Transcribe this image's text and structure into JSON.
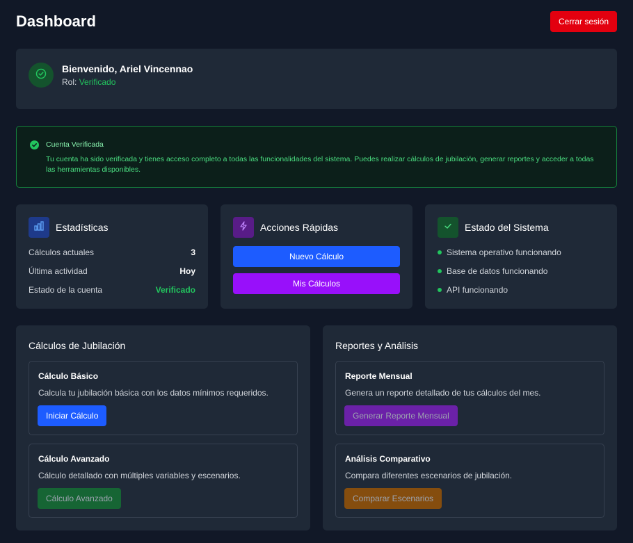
{
  "header": {
    "title": "Dashboard",
    "logout_label": "Cerrar sesión"
  },
  "welcome": {
    "greeting": "Bienvenido, Ariel Vincennao",
    "role_label": "Rol:",
    "role_value": "Verificado"
  },
  "alert": {
    "title": "Cuenta Verificada",
    "message": "Tu cuenta ha sido verificada y tienes acceso completo a todas las funcionalidades del sistema. Puedes realizar cálculos de jubilación, generar reportes y acceder a todas las herramientas disponibles."
  },
  "stats": {
    "title": "Estadísticas",
    "rows": [
      {
        "label": "Cálculos actuales",
        "value": "3"
      },
      {
        "label": "Última actividad",
        "value": "Hoy"
      },
      {
        "label": "Estado de la cuenta",
        "value": "Verificado"
      }
    ]
  },
  "quick_actions": {
    "title": "Acciones Rápidas",
    "new_calc_label": "Nuevo Cálculo",
    "my_calcs_label": "Mis Cálculos"
  },
  "system_status": {
    "title": "Estado del Sistema",
    "items": [
      "Sistema operativo funcionando",
      "Base de datos funcionando",
      "API funcionando"
    ]
  },
  "retirement": {
    "title": "Cálculos de Jubilación",
    "basic": {
      "title": "Cálculo Básico",
      "desc": "Calcula tu jubilación básica con los datos mínimos requeridos.",
      "button": "Iniciar Cálculo"
    },
    "advanced": {
      "title": "Cálculo Avanzado",
      "desc": "Cálculo detallado con múltiples variables y escenarios.",
      "button": "Cálculo Avanzado"
    }
  },
  "reports": {
    "title": "Reportes y Análisis",
    "monthly": {
      "title": "Reporte Mensual",
      "desc": "Genera un reporte detallado de tus cálculos del mes.",
      "button": "Generar Reporte Mensual"
    },
    "comparative": {
      "title": "Análisis Comparativo",
      "desc": "Compara diferentes escenarios de jubilación.",
      "button": "Comparar Escenarios"
    }
  },
  "colors": {
    "background": "#111827",
    "card": "#1f2937",
    "danger": "#e3000f",
    "primary": "#1d5cff",
    "purple": "#9810fa",
    "success": "#22c55e"
  }
}
